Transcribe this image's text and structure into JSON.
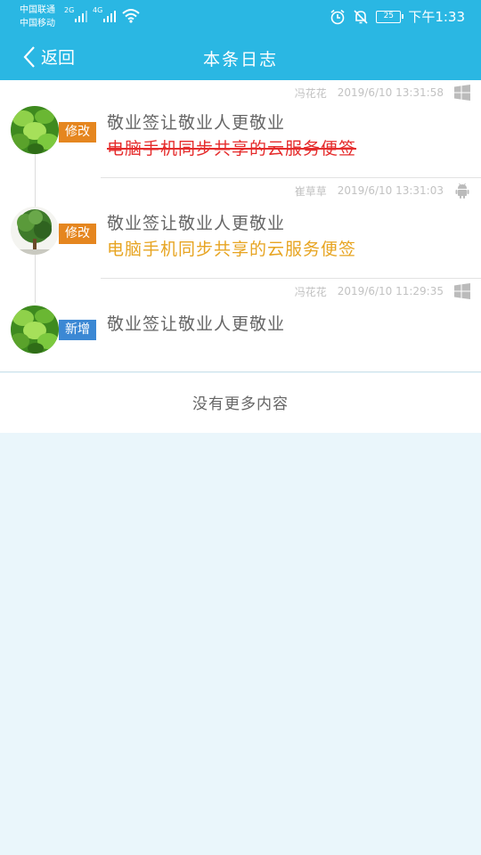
{
  "status_bar": {
    "carrier_1": "中国联通",
    "carrier_2": "中国移动",
    "network_1": "2G",
    "network_2": "4G",
    "battery": "25",
    "time": "下午1:33"
  },
  "nav": {
    "back_label": "返回",
    "title": "本条日志"
  },
  "entries": [
    {
      "user": "冯花花",
      "timestamp": "2019/6/10  13:31:58",
      "platform": "windows-icon",
      "action": "修改",
      "line1": "敬业签让敬业人更敬业",
      "line2": "电脑手机同步共享的云服务便签"
    },
    {
      "user": "崔草草",
      "timestamp": "2019/6/10  13:31:03",
      "platform": "android-icon",
      "action": "修改",
      "line1": "敬业签让敬业人更敬业",
      "line2": "电脑手机同步共享的云服务便签"
    },
    {
      "user": "冯花花",
      "timestamp": "2019/6/10  11:29:35",
      "platform": "windows-icon",
      "action": "新增",
      "line1": "敬业签让敬业人更敬业"
    }
  ],
  "footer": {
    "no_more": "没有更多内容"
  },
  "colors": {
    "primary": "#2ab7e3",
    "modify_tag": "#e5861f",
    "add_tag": "#3b88d4",
    "deleted_text": "#e52b2b",
    "added_text": "#e7a421",
    "background": "#eaf6fb"
  }
}
